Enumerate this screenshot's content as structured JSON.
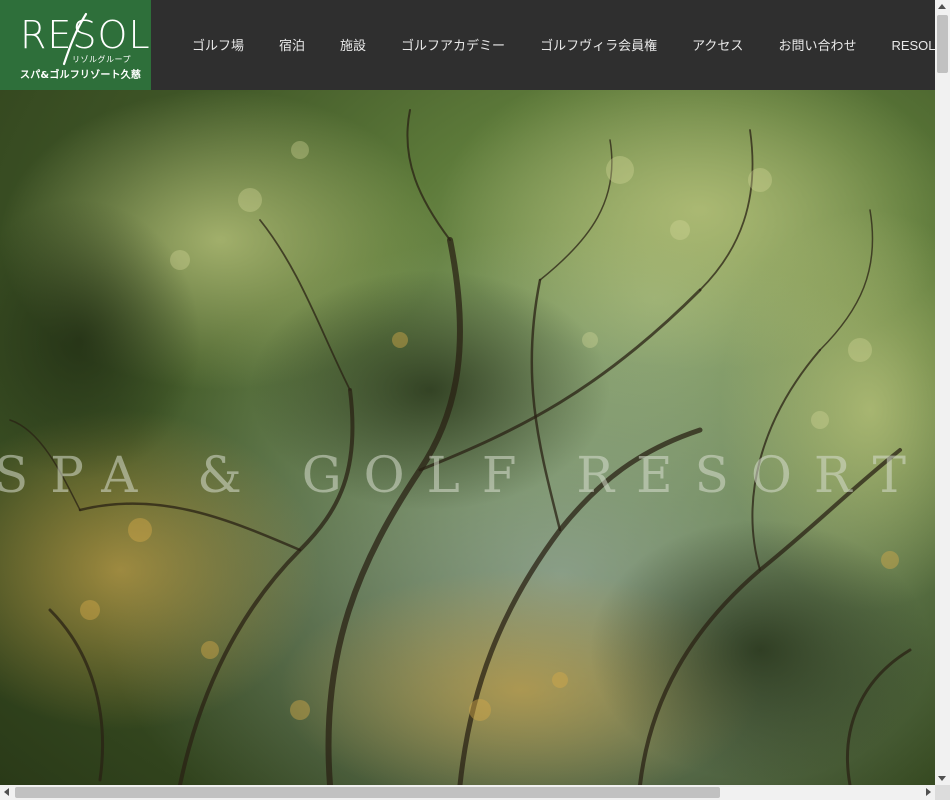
{
  "header": {
    "logo": {
      "wordmark": "RESOL",
      "group": "リゾルグループ",
      "name": "スパ&ゴルフリゾート久慈"
    },
    "nav": [
      {
        "label": "ゴルフ場"
      },
      {
        "label": "宿泊"
      },
      {
        "label": "施設"
      },
      {
        "label": "ゴルフアカデミー"
      },
      {
        "label": "ゴルフヴィラ会員権"
      },
      {
        "label": "アクセス"
      },
      {
        "label": "お問い合わせ"
      },
      {
        "label": "RESOL GOLF GROUP"
      }
    ]
  },
  "hero": {
    "title": "SPA & GOLF RESORT KUJI"
  },
  "colors": {
    "header_bg": "#2f2f2f",
    "logo_bg": "#2e6f3a",
    "nav_text": "#e8e8e8"
  }
}
